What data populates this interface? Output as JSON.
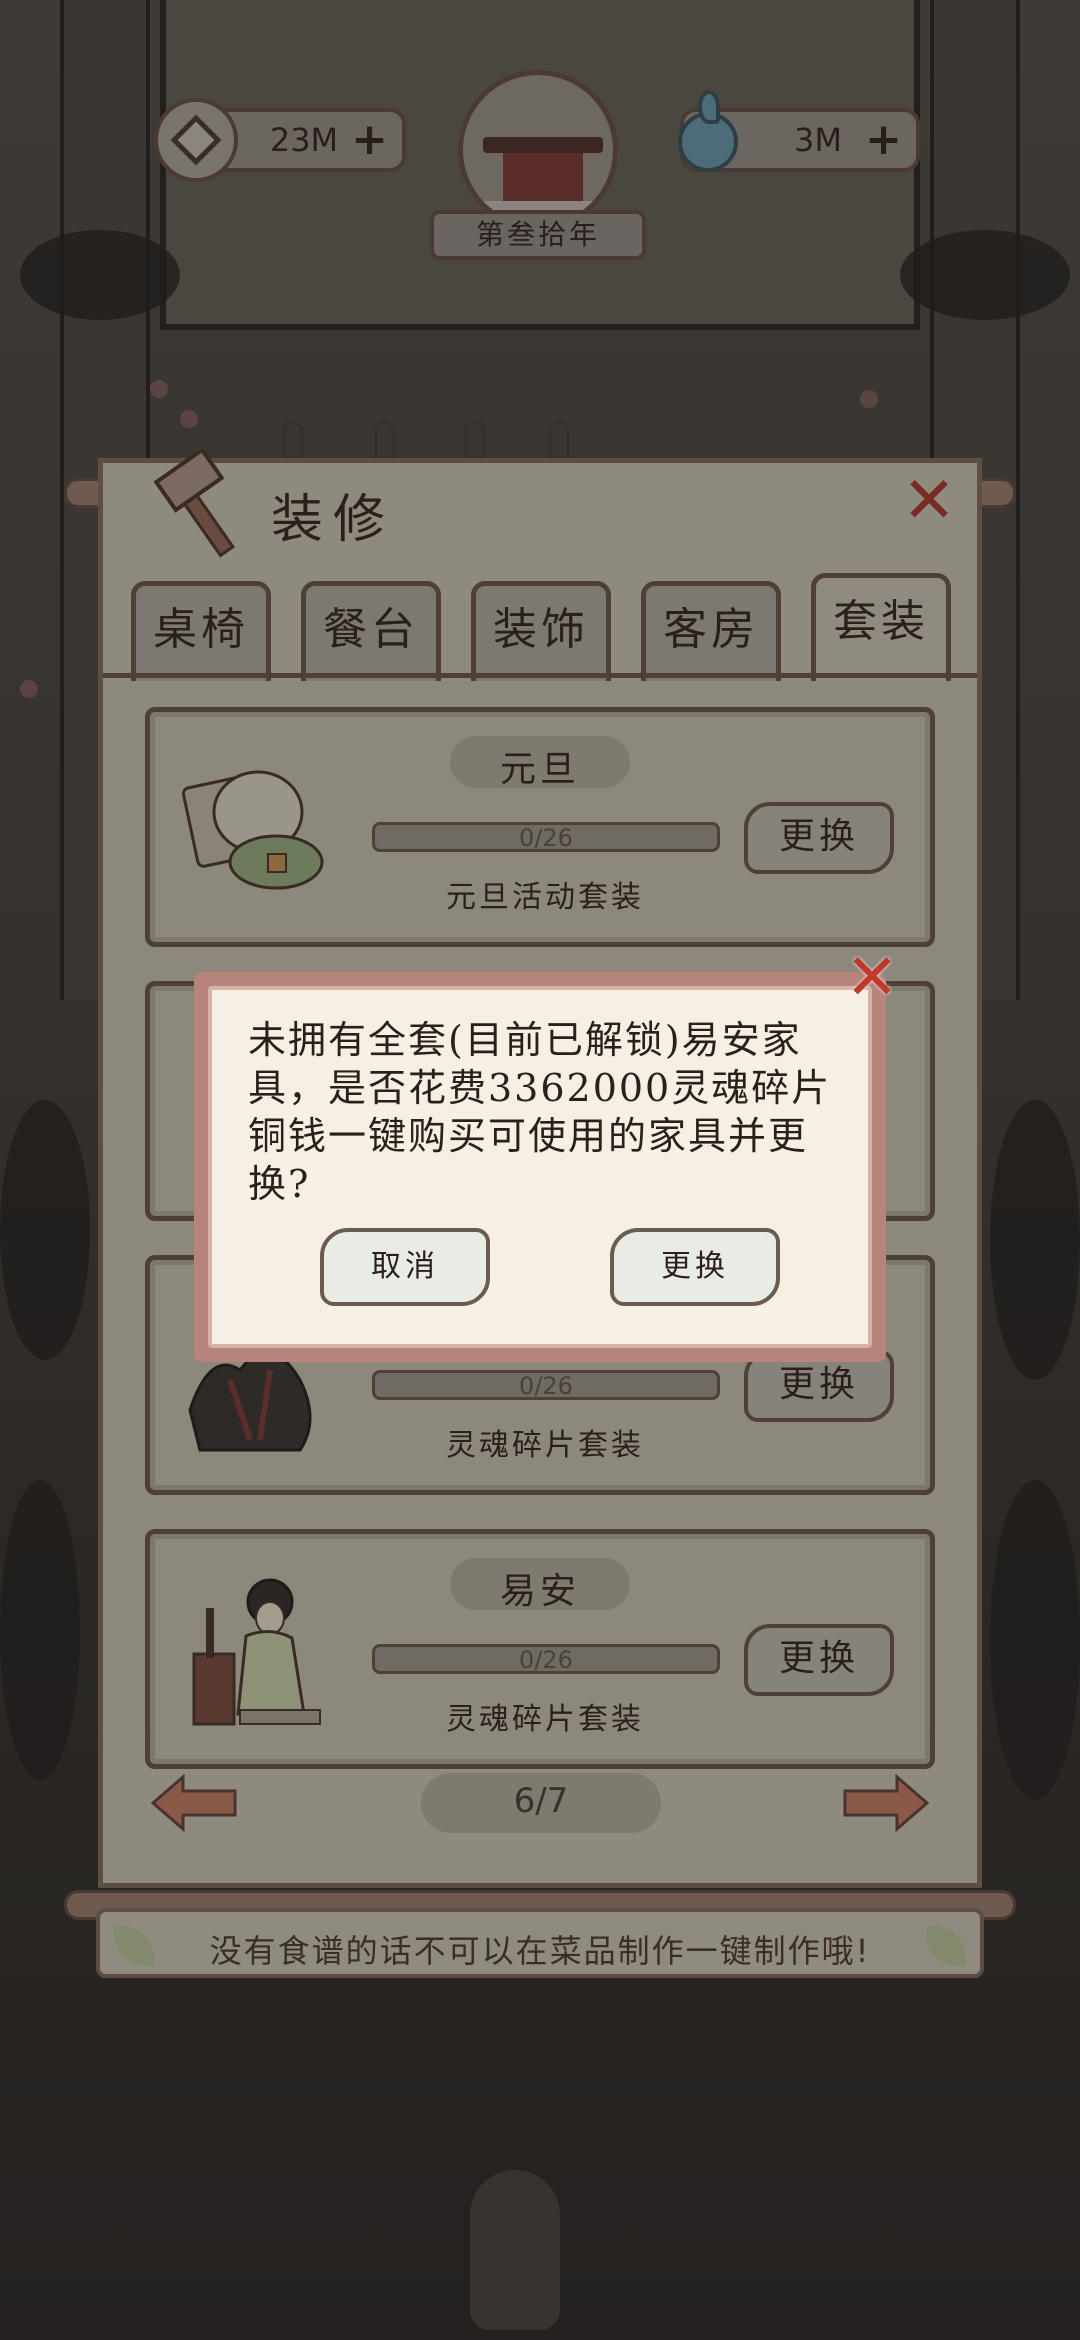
{
  "hud": {
    "coins": "23M",
    "coins_plus": "+",
    "souls": "3M",
    "souls_plus": "+",
    "year": "第叁拾年"
  },
  "panel": {
    "title": "装修",
    "close": "✕",
    "tabs": [
      "桌椅",
      "餐台",
      "装饰",
      "客房",
      "套装"
    ],
    "active_tab": 4
  },
  "cards": [
    {
      "name": "元旦",
      "progress_text": "0/26",
      "progress": 0.0,
      "subtitle": "元旦活动套装",
      "button": "更换"
    },
    {
      "name": "",
      "progress_text": "0/26",
      "progress": 0.0,
      "subtitle": "灵魂碎片套装",
      "button": "更换"
    },
    {
      "name": "易安",
      "progress_text": "0/26",
      "progress": 0.0,
      "subtitle": "灵魂碎片套装",
      "button": "更换"
    }
  ],
  "pager": {
    "text": "6/7"
  },
  "tip": "没有食谱的话不可以在菜品制作一键制作哦!",
  "dialog": {
    "message": "未拥有全套(目前已解锁)易安家具，是否花费3362000灵魂碎片铜钱一键购买可使用的家具并更换?",
    "cancel": "取消",
    "confirm": "更换",
    "close": "✕"
  },
  "colors": {
    "accent_red": "#c0392b",
    "panel_border": "#4e3f38",
    "dialog_frame": "#b7847a",
    "dialog_bg": "#f6efe4"
  }
}
